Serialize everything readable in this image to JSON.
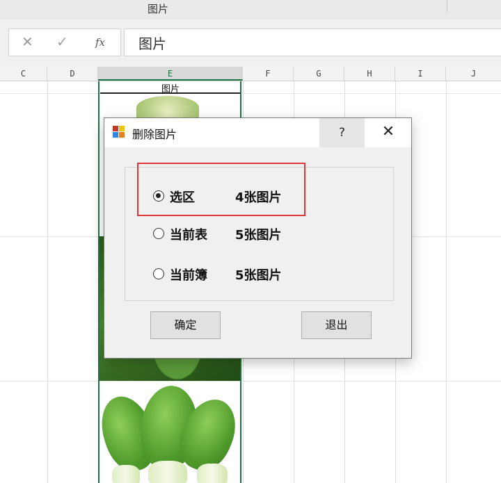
{
  "window": {
    "top_label": "图片"
  },
  "formula_bar": {
    "cancel_icon": "x-icon",
    "enter_icon": "check-icon",
    "function_icon": "fx-icon",
    "fx_text": "fx",
    "content": "图片"
  },
  "columns": [
    "C",
    "D",
    "E",
    "F",
    "G",
    "H",
    "I",
    "J"
  ],
  "selected_column": "E",
  "cell_header": "图片",
  "dialog": {
    "title": "删除图片",
    "help_label": "?",
    "close_label": "✕",
    "options": [
      {
        "label": "选区",
        "count": "4张图片",
        "selected": true
      },
      {
        "label": "当前表",
        "count": "5张图片",
        "selected": false
      },
      {
        "label": "当前簿",
        "count": "5张图片",
        "selected": false
      }
    ],
    "ok_label": "确定",
    "exit_label": "退出"
  },
  "colors": {
    "highlight": "#e0363a",
    "selection_green": "#1e7145"
  }
}
